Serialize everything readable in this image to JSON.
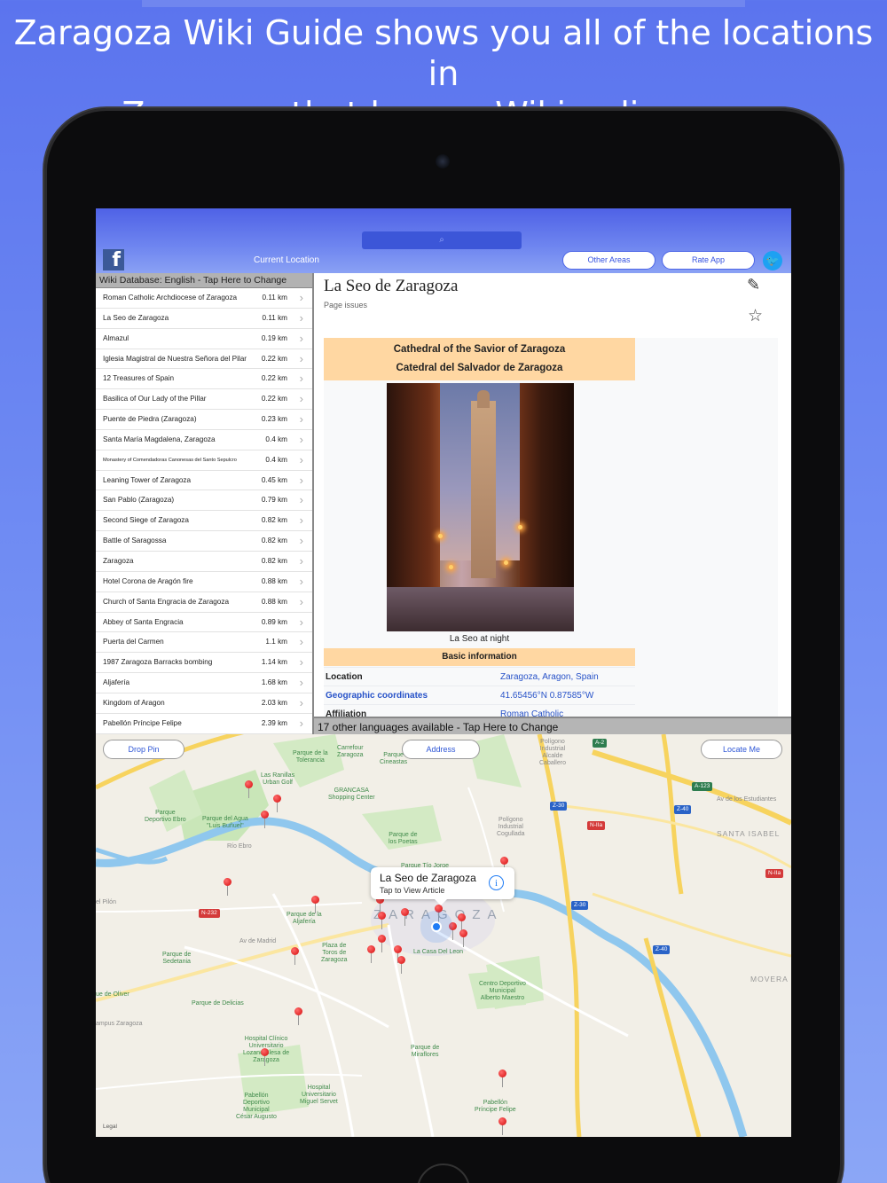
{
  "headline": {
    "line1": "Zaragoza Wiki Guide shows you all of the locations in",
    "line2": "Zaragoza that have a Wikipedia page."
  },
  "topbar": {
    "current_location": "Current Location",
    "other_areas": "Other Areas",
    "rate_app": "Rate App",
    "search_glyph": "⌕"
  },
  "list": {
    "header": "Wiki Database: English - Tap Here to Change",
    "items": [
      {
        "name": "Roman Catholic Archdiocese of Zaragoza",
        "dist": "0.11 km"
      },
      {
        "name": "La Seo de Zaragoza",
        "dist": "0.11 km"
      },
      {
        "name": "Almazul",
        "dist": "0.19 km"
      },
      {
        "name": "Iglesia Magistral de Nuestra Señora del Pilar",
        "dist": "0.22 km"
      },
      {
        "name": "12 Treasures of Spain",
        "dist": "0.22 km"
      },
      {
        "name": "Basilica of Our Lady of the Pillar",
        "dist": "0.22 km"
      },
      {
        "name": "Puente de Piedra (Zaragoza)",
        "dist": "0.23 km"
      },
      {
        "name": "Santa María Magdalena, Zaragoza",
        "dist": "0.4 km"
      },
      {
        "name": "Monastery of Comendadoras Canonesas del Santo Sepulcro",
        "dist": "0.4 km"
      },
      {
        "name": "Leaning Tower of Zaragoza",
        "dist": "0.45 km"
      },
      {
        "name": "San Pablo (Zaragoza)",
        "dist": "0.79 km"
      },
      {
        "name": "Second Siege of Zaragoza",
        "dist": "0.82 km"
      },
      {
        "name": "Battle of Saragossa",
        "dist": "0.82 km"
      },
      {
        "name": "Zaragoza",
        "dist": "0.82 km"
      },
      {
        "name": "Hotel Corona de Aragón fire",
        "dist": "0.88 km"
      },
      {
        "name": "Church of Santa Engracia de Zaragoza",
        "dist": "0.88 km"
      },
      {
        "name": "Abbey of Santa Engracia",
        "dist": "0.89 km"
      },
      {
        "name": "Puerta del Carmen",
        "dist": "1.1 km"
      },
      {
        "name": "1987 Zaragoza Barracks bombing",
        "dist": "1.14 km"
      },
      {
        "name": "Aljafería",
        "dist": "1.68 km"
      },
      {
        "name": "Kingdom of Aragon",
        "dist": "2.03 km"
      },
      {
        "name": "Pabellón Príncipe Felipe",
        "dist": "2.39 km"
      }
    ]
  },
  "article": {
    "title": "La Seo de Zaragoza",
    "page_issues": "Page issues",
    "infobox_title1": "Cathedral of the Savior of Zaragoza",
    "infobox_title2": "Catedral del Salvador de Zaragoza",
    "caption": "La Seo at night",
    "basic_info": "Basic information",
    "rows": [
      {
        "k": "Location",
        "v": "Zaragoza, Aragon, Spain"
      },
      {
        "k": "Geographic coordinates",
        "v": "41.65456°N 0.87585°W"
      },
      {
        "k": "Affiliation",
        "v": "Roman Catholic"
      }
    ]
  },
  "lang_bar": "17 other languages available - Tap Here to Change",
  "map": {
    "drop_pin": "Drop Pin",
    "address": "Address",
    "locate_me": "Locate Me",
    "callout_title": "La Seo de Zaragoza",
    "callout_sub": "Tap to View Article",
    "legal": "Legal",
    "city": "ZARAGOZA",
    "labels": {
      "ranillas": "Las Ranillas\nUrban Golf",
      "tolerancia": "Parque de la\nTolerancia",
      "carrefour": "Carrefour\nZaragoza",
      "cineastas": "Parque\nCineastas",
      "grancasa": "GRANCASA\nShopping Center",
      "deportivo_ebro": "Parque\nDeportivo Ebro",
      "parque_agua": "Parque del Agua\n\"Luis Buñuel\"",
      "poetas": "Parque de\nlos Poetas",
      "tio_jorge": "Parque Tío Jorge",
      "poligono_cogullada": "Polígono\nIndustrial\nCogullada",
      "poligono_malpica": "Polígono\nIndustrial\nAlcalde\nCaballero",
      "santa_isabel": "SANTA ISABEL",
      "aljaferia": "Parque de la\nAljafería",
      "toros": "Plaza de\nToros de\nZaragoza",
      "casa_leon": "La Casa Del Leon",
      "sedetania": "Parque de\nSedetania",
      "oliver": "ue de Oliver",
      "delicias": "Parque de Delicias",
      "centro_deportivo": "Centro Deportivo\nMunicipal\nAlberto Maestro",
      "hospital_clinico": "Hospital Clínico\nUniversitario\nLozano Blesa de\nZaragoza",
      "miraflores": "Parque de\nMiraflores",
      "hospital_servet": "Hospital\nUniversitario\nMiguel Servet",
      "pabellon_felipe": "Pabellón\nPríncipe Felipe",
      "pabellon_cesar": "Pabellón\nDeportivo\nMunicipal\nCésar Augusto",
      "movera": "MOVERA",
      "pilon": "el Pilón",
      "rio_ebro": "Río Ebro",
      "estudiantes": "Av de los Estudiantes",
      "campus": "ampus Zaragoza",
      "av_madrid": "Av de Madrid"
    },
    "roads": {
      "a2": "A-2",
      "a123": "A-123",
      "z30a": "Z-30",
      "z40a": "Z-40",
      "n2a": "N-IIa",
      "n2a_b": "N-IIa",
      "z30b": "Z-30",
      "z40b": "Z-40",
      "n232": "N-232"
    }
  },
  "colors": {
    "accent": "#3552e0",
    "header_bg": "#5b74ee",
    "pin": "#d40c0c",
    "infobox": "#ffd7a2",
    "link": "#2752c8"
  }
}
